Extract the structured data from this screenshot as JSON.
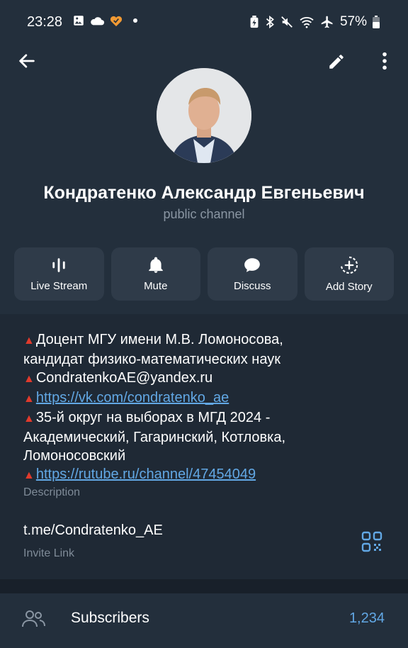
{
  "status_bar": {
    "time": "23:28",
    "battery": "57%"
  },
  "profile": {
    "name": "Кондратенко Александр Евгеньевич",
    "subtitle": "public channel"
  },
  "actions": [
    {
      "label": "Live Stream",
      "icon": "live-stream-icon"
    },
    {
      "label": "Mute",
      "icon": "bell-icon"
    },
    {
      "label": "Discuss",
      "icon": "chat-bubble-icon"
    },
    {
      "label": "Add Story",
      "icon": "add-story-icon"
    }
  ],
  "description": {
    "line1": "Доцент МГУ имени М.В. Ломоносова,",
    "line2": "кандидат физико-математических наук",
    "email": "CondratenkoAE@yandex.ru",
    "vk": "https://vk.com/condratenko_ae",
    "line5": "35-й округ на выборах в МГД 2024 -",
    "line6": "Академический, Гагаринский, Котловка,",
    "line7": "Ломоносовский",
    "rutube": "https://rutube.ru/channel/47454049",
    "caption": "Description"
  },
  "invite": {
    "link": "t.me/Condratenko_AE",
    "caption": "Invite Link"
  },
  "subscribers": {
    "label": "Subscribers",
    "count": "1,234"
  },
  "colors": {
    "background": "#232f3c",
    "accent": "#62a8e5",
    "marker": "#e03a2c"
  }
}
